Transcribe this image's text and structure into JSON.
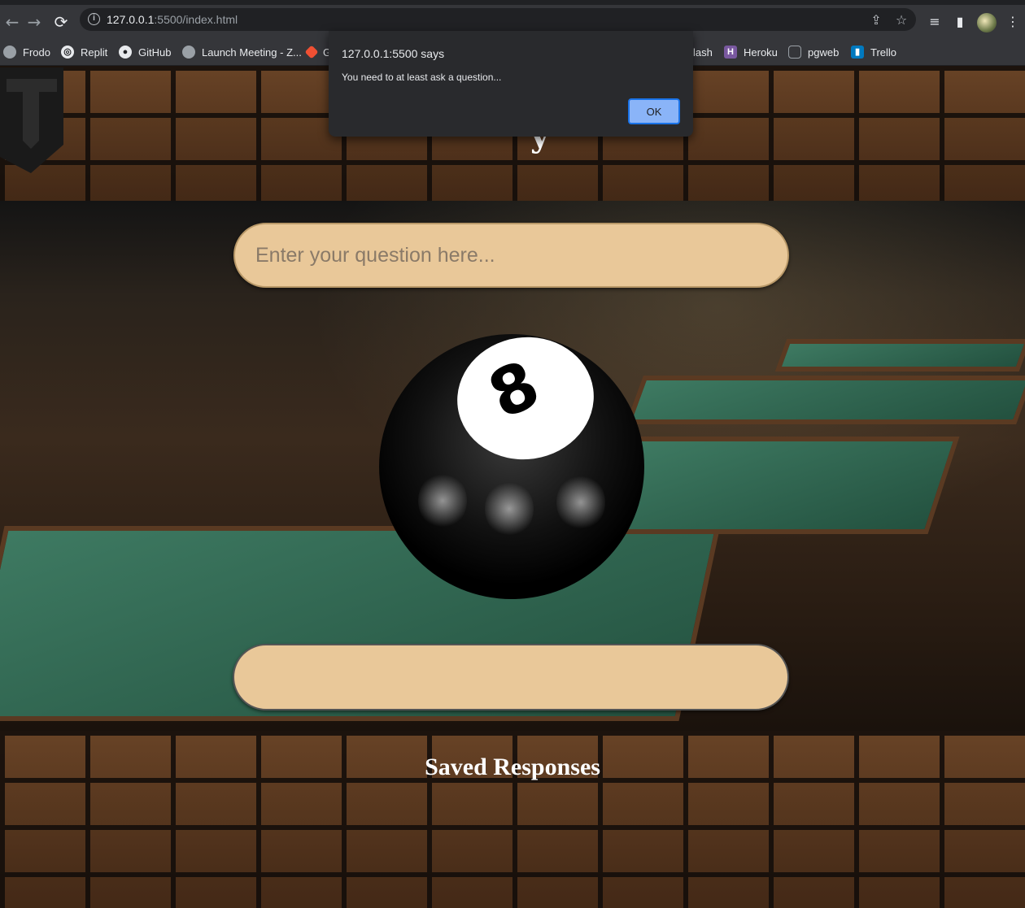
{
  "browser": {
    "url_host": "127.0.0.1",
    "url_path": ":5500/index.html",
    "back_icon": "←",
    "forward_icon": "→",
    "reload_icon": "⟳",
    "share_icon": "⇪",
    "star_icon": "☆",
    "media_icon": "≡",
    "sidepanel_icon": "▮",
    "menu_icon": "⋮"
  },
  "bookmarks": [
    {
      "label": "Frodo",
      "icon": "globe-icon",
      "color": "#9aa0a6"
    },
    {
      "label": "Replit",
      "icon": "replit-icon",
      "color": "#f26207"
    },
    {
      "label": "GitHub",
      "icon": "github-icon",
      "color": "#ffffff"
    },
    {
      "label": "Launch Meeting - Z...",
      "icon": "globe-icon",
      "color": "#9aa0a6"
    },
    {
      "label": "G",
      "icon": "git-icon",
      "color": "#f05033"
    },
    {
      "label": "lash",
      "icon": "",
      "color": ""
    },
    {
      "label": "Heroku",
      "icon": "heroku-icon",
      "color": "#79589f"
    },
    {
      "label": "pgweb",
      "icon": "database-icon",
      "color": "#9aa0a6"
    },
    {
      "label": "Trello",
      "icon": "trello-icon",
      "color": "#0079bf"
    }
  ],
  "page": {
    "title_glyph": "y",
    "question_placeholder": "Enter your question here...",
    "answer_text": "",
    "ball_number": "8",
    "saved_heading": "Saved Responses"
  },
  "alert": {
    "title": "127.0.0.1:5500 says",
    "message": "You need to at least ask a question...",
    "ok_label": "OK"
  },
  "colors": {
    "input_fill": "#e9c899",
    "dialog_bg": "#292a2d",
    "ok_button": "#8ab4f8"
  }
}
